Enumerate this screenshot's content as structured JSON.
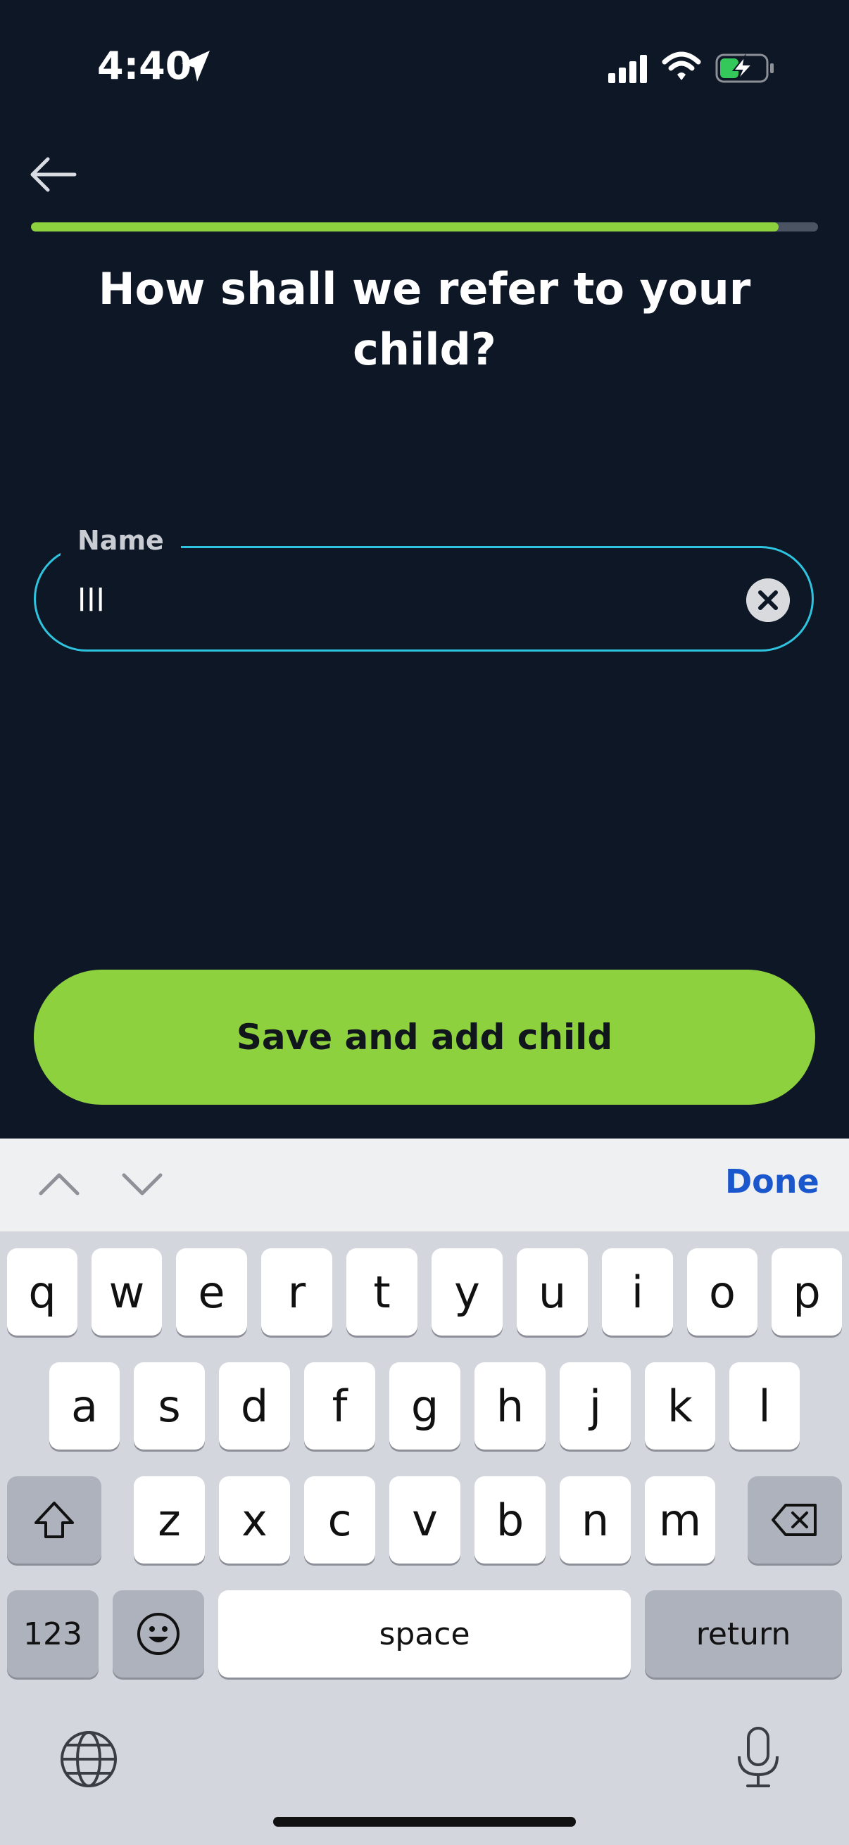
{
  "status_bar": {
    "time": "4:40",
    "icons": [
      "location-arrow-icon",
      "signal-icon",
      "wifi-icon",
      "battery-charging-icon"
    ],
    "battery_color": "#34c759"
  },
  "nav": {
    "back_icon": "arrow-left-icon"
  },
  "progress": {
    "fraction": 0.95,
    "fill_color": "#8dd13e",
    "track_color": "#4a5462"
  },
  "title": "How shall we refer to your child?",
  "name_field": {
    "label": "Name",
    "value": "lll",
    "clear_icon": "clear-circle-icon",
    "border_color": "#2ec4df"
  },
  "save_button": {
    "label": "Save and add child",
    "color": "#8dd13e"
  },
  "keyboard": {
    "accessory": {
      "prev_icon": "chevron-up-icon",
      "next_icon": "chevron-down-icon",
      "done_label": "Done"
    },
    "row1": [
      "q",
      "w",
      "e",
      "r",
      "t",
      "y",
      "u",
      "i",
      "o",
      "p"
    ],
    "row2": [
      "a",
      "s",
      "d",
      "f",
      "g",
      "h",
      "j",
      "k",
      "l"
    ],
    "row3": [
      "z",
      "x",
      "c",
      "v",
      "b",
      "n",
      "m"
    ],
    "shift_icon": "shift-icon",
    "delete_icon": "backspace-icon",
    "numbers_label": "123",
    "emoji_icon": "emoji-icon",
    "space_label": "space",
    "return_label": "return",
    "globe_icon": "globe-icon",
    "mic_icon": "microphone-icon"
  }
}
